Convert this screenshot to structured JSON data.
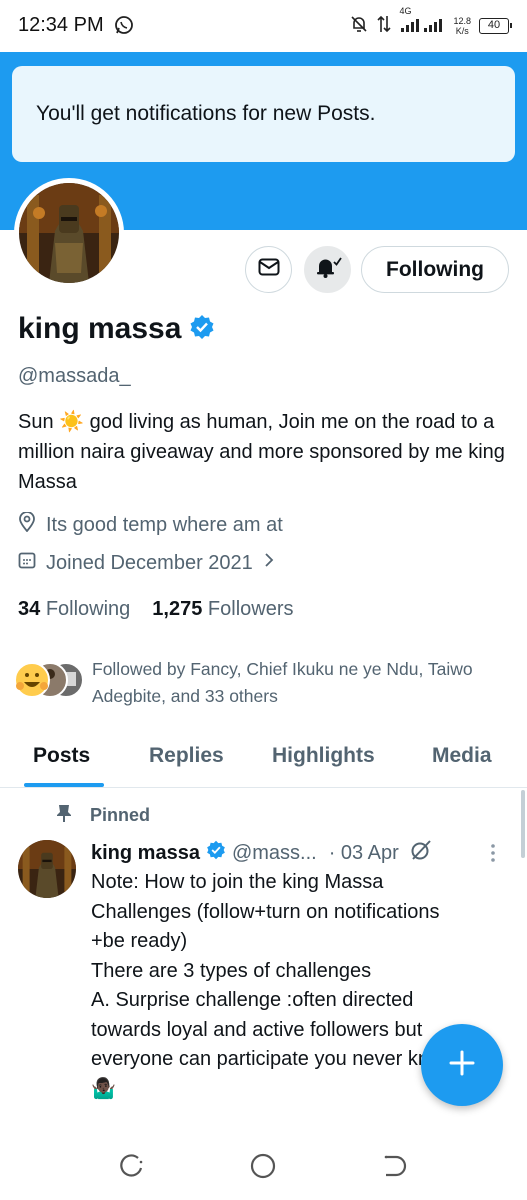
{
  "status_bar": {
    "time": "12:34 PM",
    "net_speed_value": "12.8",
    "net_speed_unit": "K/s",
    "battery": "40",
    "network_label": "4G"
  },
  "toast": {
    "text": "You'll get notifications for new Posts."
  },
  "profile": {
    "display_name": "king massa",
    "handle": "@massada_",
    "bio": "Sun ☀️ god living as human, Join me on the road to a million naira giveaway and more sponsored by me king Massa",
    "location": "Its good temp where am at",
    "joined": "Joined December 2021",
    "following_count": "34",
    "following_label": "Following",
    "followers_count": "1,275",
    "followers_label": "Followers",
    "followed_by": "Followed by Fancy, Chief Ikuku ne ye Ndu, Taiwo Adegbite, and 33 others",
    "follow_button_label": "Following"
  },
  "tabs": [
    "Posts",
    "Replies",
    "Highlights",
    "Media"
  ],
  "pinned_post": {
    "pinned_label": "Pinned",
    "author_name": "king massa",
    "author_handle": "@mass...",
    "date": "· 03 Apr",
    "lines": [
      "Note: How to join the king Massa",
      "Challenges (follow+turn on notifications",
      "+be ready)",
      "There are 3 types of challenges",
      "A. Surprise challenge :often directed",
      "towards loyal and active followers but",
      "everyone can participate you never know",
      "🤷🏿‍♂️"
    ]
  },
  "colors": {
    "accent": "#1d9bf0",
    "text_primary": "#0f1419",
    "text_secondary": "#536471"
  }
}
